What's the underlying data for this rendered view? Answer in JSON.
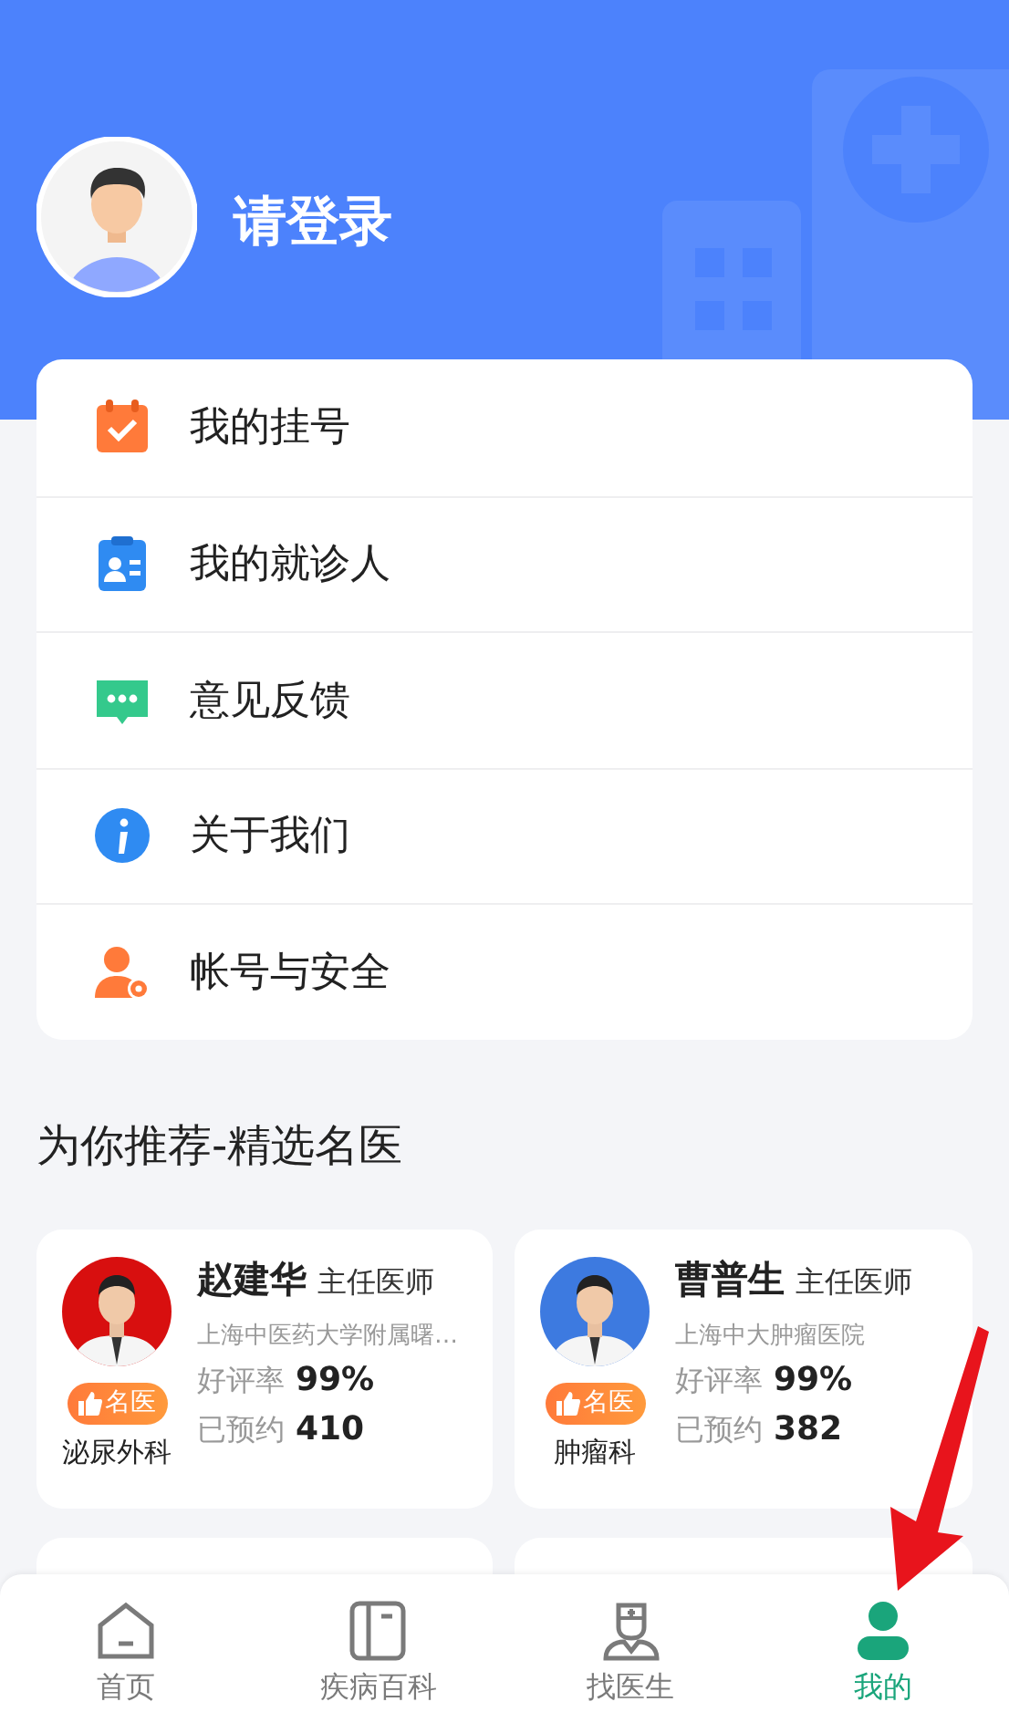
{
  "profile": {
    "login_prompt": "请登录"
  },
  "menu": [
    {
      "label": "我的挂号"
    },
    {
      "label": "我的就诊人"
    },
    {
      "label": "意见反馈"
    },
    {
      "label": "关于我们"
    },
    {
      "label": "帐号与安全"
    }
  ],
  "recommend": {
    "title": "为你推荐-精选名医",
    "doctors": [
      {
        "name": "赵建华",
        "title": "主任医师",
        "hospital": "上海中医药大学附属曙…",
        "badge": "名医",
        "department": "泌尿外科",
        "rating_label": "好评率",
        "rating": "99%",
        "booked_label": "已预约",
        "booked": "410"
      },
      {
        "name": "曹普生",
        "title": "主任医师",
        "hospital": "上海中大肿瘤医院",
        "badge": "名医",
        "department": "肿瘤科",
        "rating_label": "好评率",
        "rating": "99%",
        "booked_label": "已预约",
        "booked": "382"
      }
    ]
  },
  "tab_bar": [
    {
      "label": "首页",
      "selected": false
    },
    {
      "label": "疾病百科",
      "selected": false
    },
    {
      "label": "找医生",
      "selected": false
    },
    {
      "label": "我的",
      "selected": true
    }
  ]
}
